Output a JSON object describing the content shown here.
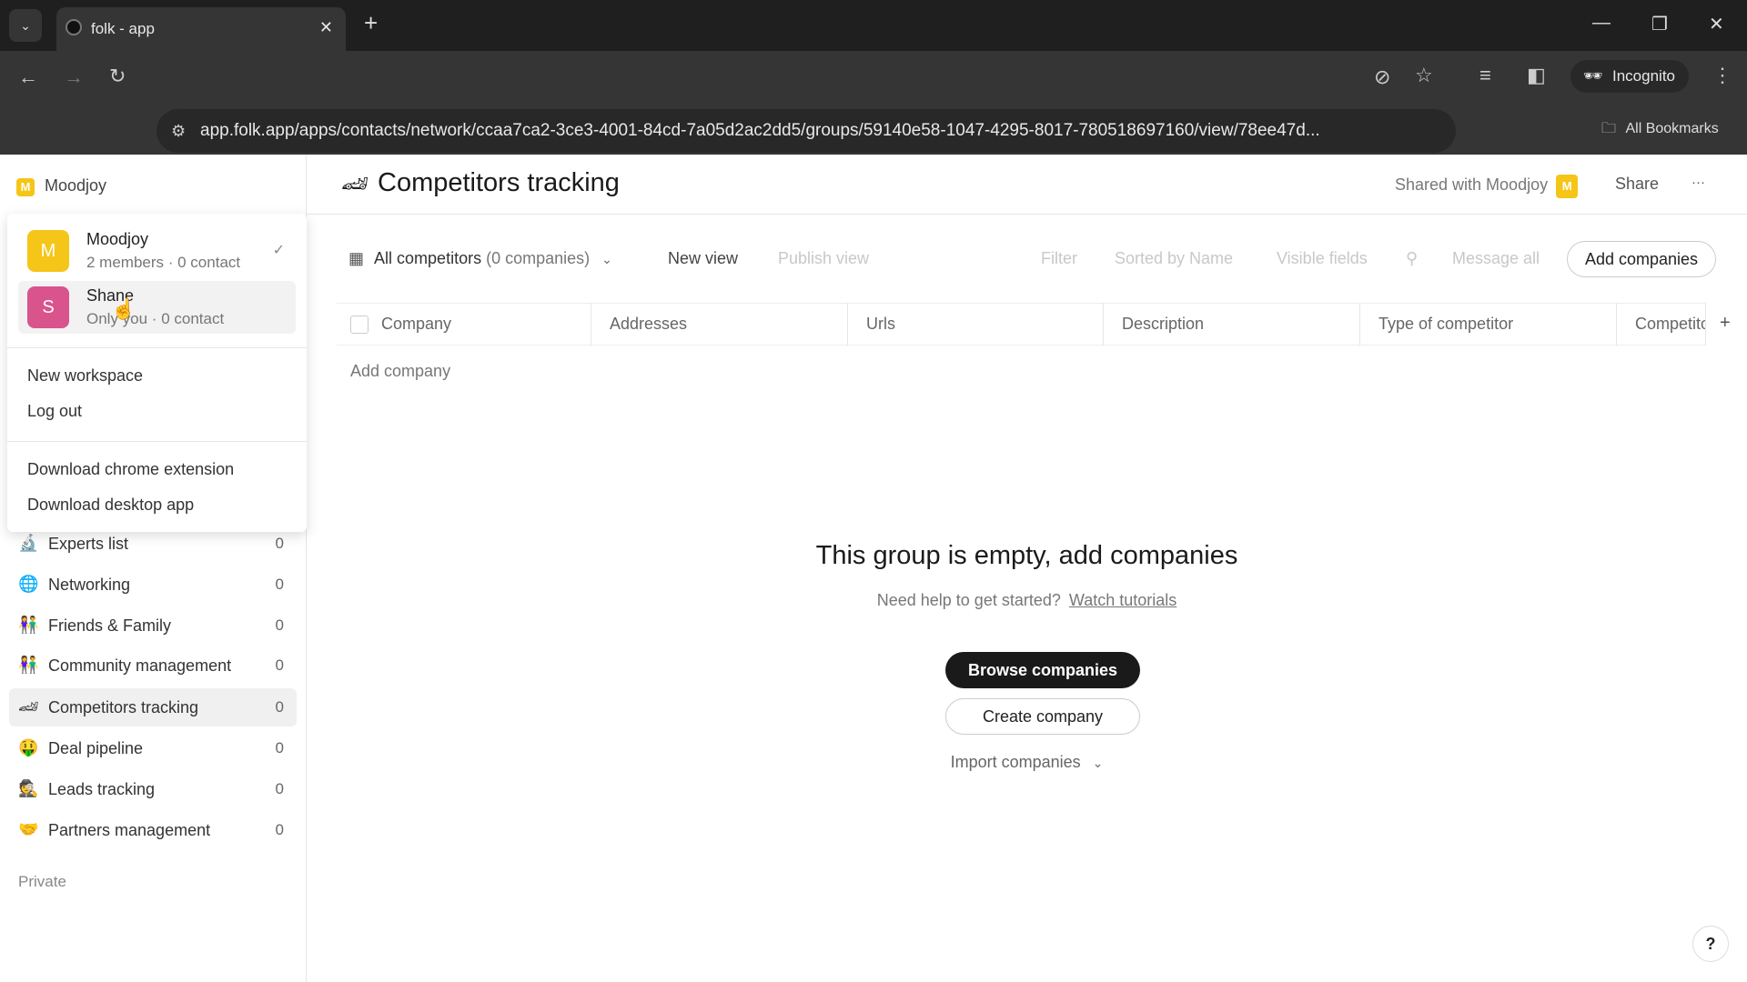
{
  "browser": {
    "tab_title": "folk - app",
    "url": "app.folk.app/apps/contacts/network/ccaa7ca2-3ce3-4001-84cd-7a05d2ac2dd5/groups/59140e58-1047-4295-8017-780518697160/view/78ee47d...",
    "profile": "Incognito",
    "bookmarks": "All Bookmarks"
  },
  "sidebar": {
    "workspace": "Moodjoy",
    "workspace_initial": "M",
    "items": [
      {
        "icon": "🔬",
        "label": "Experts list",
        "count": "0"
      },
      {
        "icon": "🌐",
        "label": "Networking",
        "count": "0"
      },
      {
        "icon": "👫",
        "label": "Friends & Family",
        "count": "0"
      },
      {
        "icon": "👫",
        "label": "Community management",
        "count": "0"
      },
      {
        "icon": "🏎",
        "label": "Competitors tracking",
        "count": "0"
      },
      {
        "icon": "🤑",
        "label": "Deal pipeline",
        "count": "0"
      },
      {
        "icon": "🕵",
        "label": "Leads tracking",
        "count": "0"
      },
      {
        "icon": "🤝",
        "label": "Partners management",
        "count": "0"
      }
    ],
    "private_label": "Private"
  },
  "menu": {
    "workspaces": [
      {
        "initial": "M",
        "name": "Moodjoy",
        "sub": "2 members · 0 contact",
        "color": "#f5c518",
        "selected": true
      },
      {
        "initial": "S",
        "name": "Shane",
        "sub": "Only you · 0 contact",
        "color": "#d9538c"
      }
    ],
    "new_workspace": "New workspace",
    "log_out": "Log out",
    "download_extension": "Download chrome extension",
    "download_desktop": "Download desktop app"
  },
  "header": {
    "icon": "🏎",
    "title": "Competitors tracking",
    "shared_with": "Shared with Moodjoy",
    "shared_initial": "M",
    "share": "Share",
    "more": "···"
  },
  "toolbar": {
    "view_name": "All competitors",
    "view_count": "(0 companies)",
    "new_view": "New view",
    "publish_view": "Publish view",
    "filter": "Filter",
    "sort": "Sorted by Name",
    "visible_fields": "Visible fields",
    "message_all": "Message all",
    "add_companies": "Add companies"
  },
  "table": {
    "columns": [
      "Company",
      "Addresses",
      "Urls",
      "Description",
      "Type of competitor",
      "Competito"
    ],
    "add_row": "Add company"
  },
  "empty": {
    "title": "This group is empty, add companies",
    "help": "Need help to get started?",
    "tutorials": "Watch tutorials",
    "browse": "Browse companies",
    "create": "Create company",
    "import": "Import companies"
  },
  "help_button": "?"
}
